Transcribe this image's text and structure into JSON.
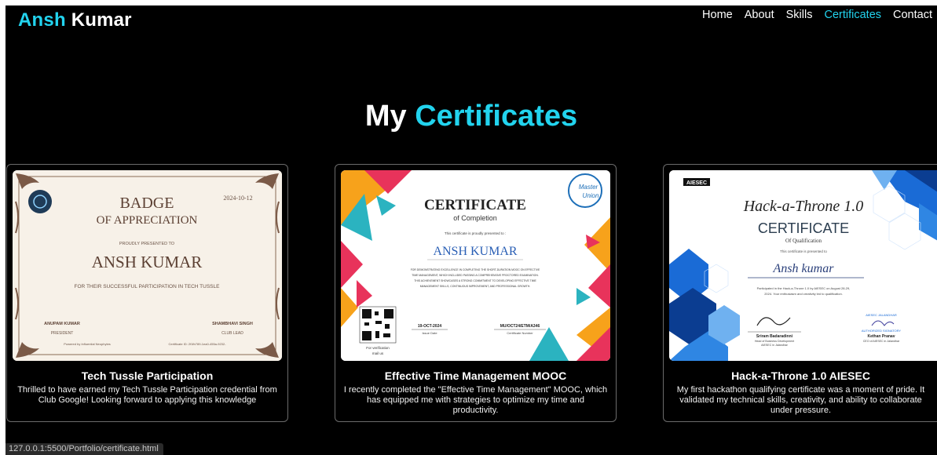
{
  "brand": {
    "first": "Ansh",
    "last": "Kumar"
  },
  "nav": {
    "home": "Home",
    "about": "About",
    "skills": "Skills",
    "certificates": "Certificates",
    "contact": "Contact"
  },
  "heading": {
    "first": "My",
    "accent": "Certificates"
  },
  "accent_color": "#22d3ee",
  "cards": [
    {
      "title": "Tech Tussle Participation",
      "description": "Thrilled to have earned my Tech Tussle Participation credential from Club Google! Looking forward to applying this knowledge",
      "cert": {
        "date": "2024-10-12",
        "line1": "BADGE",
        "line2": "OF APPRECIATION",
        "presented": "PROUDLY PRESENTED TO",
        "name": "ANSH KUMAR",
        "reason": "FOR THEIR SUCCESSFUL PARTICIPATION IN TECH TUSSLE",
        "sig1_name": "ANUPAM KUMAR",
        "sig1_role": "PRESIDENT",
        "sig2_name": "SHAMBHAVI SINGH",
        "sig2_role": "CLUB LEAD",
        "footer_left": "Powered by Influential Neophytes",
        "footer_right": "Certificate ID: 2f1fb789-1ea0-455a-9232-"
      }
    },
    {
      "title": "Effective Time Management MOOC",
      "description": "I recently completed the \"Effective Time Management\" MOOC, which has equipped me with strategies to optimize my time and productivity.",
      "cert": {
        "title": "CERTIFICATE",
        "sub": "of Completion",
        "presented": "This certificate is proudly presented to :",
        "name": "ANSH KUMAR",
        "body1": "FOR DEMONSTRATING EXCELLENCE IN COMPLETING THE SHORT-DURATION MOOC ON EFFECTIVE",
        "body2": "TIME MANAGEMENT, WHICH INCLUDED PASSING A COMPREHENSIVE PROCTORED EXAMINATION.",
        "body3": "THIS ACHIEVEMENT SHOWCASES A STRONG COMMITMENT TO DEVELOPING EFFECTIVE TIME",
        "body4": "MANAGEMENT SKILLS, CONTINUOUS IMPROVEMENT, AND PROFESSIONAL GROWTH.",
        "logo1": "Master",
        "logo2": "Union",
        "issue_date": "19-OCT-2024",
        "issue_label": "Issue Date",
        "cert_no": "MU/OCT24/ETM/A346",
        "cert_no_label": "Certificate Number",
        "verify1": "For verification",
        "verify2": "mail us"
      }
    },
    {
      "title": "Hack-a-Throne 1.0 AIESEC",
      "description": "My first hackathon qualifying certificate was a moment of pride. It validated my technical skills, creativity, and ability to collaborate under pressure.",
      "cert": {
        "brand": "AIESEC",
        "title": "Hack-a-Throne 1.0",
        "cert": "CERTIFICATE",
        "sub": "Of Qualification",
        "presented": "This certificate is presented to",
        "name": "Ansh kumar",
        "body1": "Participated in the Hack-a-Throne 1.0 by AIESEC on August 28-29,",
        "body2": "2024. Your enthusiasm and creativity led to qualification.",
        "sig1_name": "Sriram Badaradinni",
        "sig1_role1": "Head of Business Development",
        "sig1_role2": "AIESEC in Jalandhar",
        "sig2_org": "AIESEC JALANDHAR",
        "sig2_auth": "AUTHORIZED SIGNATORY",
        "sig2_name": "Kethan Pranav",
        "sig2_role": "CEO of AIESEC in Jalandhar"
      }
    }
  ],
  "status_bar": "127.0.0.1:5500/Portfolio/certificate.html"
}
